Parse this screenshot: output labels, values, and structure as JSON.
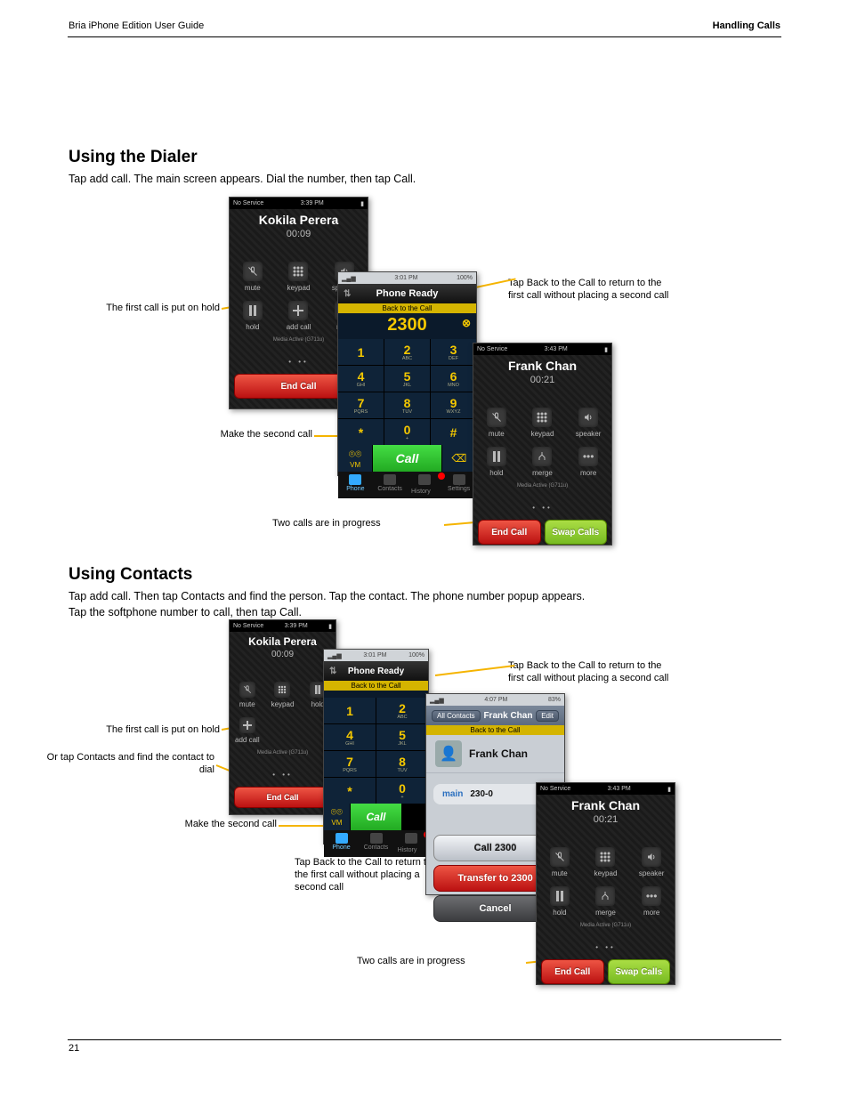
{
  "header": {
    "left": "Bria iPhone Edition User Guide",
    "right": "Handling Calls"
  },
  "footer": {
    "left": "21",
    "right": ""
  },
  "h": {
    "sec1": "Using the Dialer",
    "body1": "Tap add call. The main screen appears. Dial the number, then tap Call.",
    "sec2": "Using Contacts",
    "body2": "Tap add call. Then tap Contacts and find the person. Tap the contact. The phone number popup appears.",
    "body3": "Tap the softphone number to call, then tap Call."
  },
  "callouts": {
    "c1a": "The first call is put on hold",
    "c1b": "Tap Back to the Call to return to the first call without placing a second call",
    "c1c": "Make the second call",
    "c1d": "Two calls are in progress",
    "c2": "Or tap Contacts and find the contact to dial"
  },
  "status": {
    "noservice": "No Service",
    "wifi": "ᯤ",
    "battery": "▮",
    "batt2": "83%",
    "full": "100%"
  },
  "times": {
    "t1": "3:39 PM",
    "t2": "3:01 PM",
    "t3": "3:43 PM",
    "t4": "4:07 PM"
  },
  "incall1": {
    "name": "Kokila Perera",
    "timer": "00:09",
    "cells": [
      "mute",
      "keypad",
      "speaker",
      "hold",
      "add call",
      "more"
    ],
    "media": "Media Active (G711u)",
    "end": "End Call"
  },
  "incall2": {
    "name": "Frank Chan",
    "timer": "00:21",
    "cells": [
      "mute",
      "keypad",
      "speaker",
      "hold",
      "merge",
      "more"
    ],
    "media": "Media Active (G711u)",
    "end": "End Call",
    "swap": "Swap Calls"
  },
  "dialer": {
    "ready": "Phone Ready",
    "back": "Back to the Call",
    "number": "2300",
    "keys": [
      [
        "1",
        ""
      ],
      [
        "2",
        "ABC"
      ],
      [
        "3",
        "DEF"
      ],
      [
        "4",
        "GHI"
      ],
      [
        "5",
        "JKL"
      ],
      [
        "6",
        "MNO"
      ],
      [
        "7",
        "PQRS"
      ],
      [
        "8",
        "TUV"
      ],
      [
        "9",
        "WXYZ"
      ],
      [
        "*",
        ""
      ],
      [
        "0",
        "+"
      ],
      [
        "#",
        ""
      ]
    ],
    "vm": "VM",
    "call": "Call",
    "bksp": "⌫",
    "tabs": [
      "Phone",
      "Contacts",
      "History",
      "Settings"
    ]
  },
  "contact": {
    "back": "All Contacts",
    "title": "Frank Chan",
    "edit": "Edit",
    "yellow": "Back to the Call",
    "name": "Frank Chan",
    "numlabel": "main",
    "num": "230-0",
    "act1": "Call 2300",
    "act2": "Transfer to 2300",
    "act3": "Cancel"
  }
}
